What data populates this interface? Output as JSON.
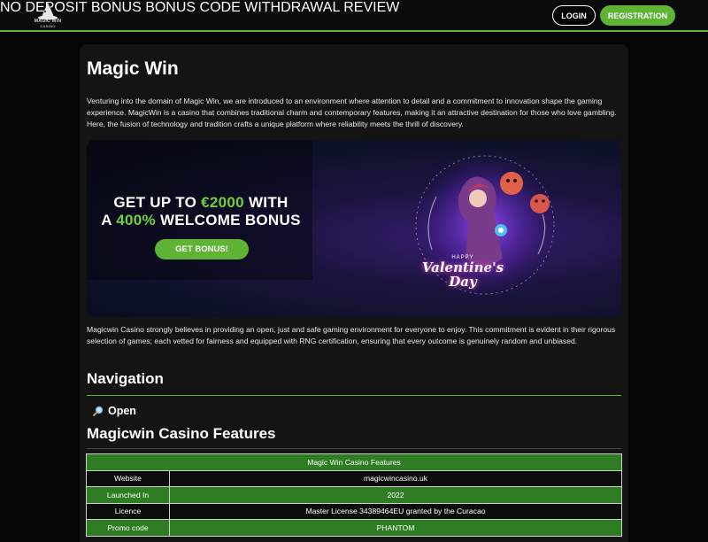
{
  "header": {
    "logo_text_line1": "MAGIC WIN",
    "logo_text_line2": "CASINO",
    "nav": [
      "NO DEPOSIT BONUS",
      "BONUS CODE",
      "WITHDRAWAL",
      "REVIEW"
    ],
    "login_label": "LOGIN",
    "register_label": "REGISTRATION"
  },
  "colors": {
    "accent": "#5fb335",
    "background": "#050505",
    "card": "#141414",
    "table_green": "#2e7d23"
  },
  "main": {
    "title": "Magic Win",
    "intro": "Venturing into the domain of Magic Win, we are introduced to an environment where attention to detail and a commitment to innovation shape the gaming experience. MagicWin is a casino that combines traditional charm and contemporary features, making it an attractive destination for those who love gambling. Here, the fusion of technology and tradition crafts a unique platform where reliability meets the thrill of discovery.",
    "banner": {
      "line1_pre": "GET UP TO ",
      "line1_amount": "€2000",
      "line1_post": " WITH",
      "line2_pre": "A ",
      "line2_percent": "400%",
      "line2_post": " WELCOME BONUS",
      "button": "GET BONUS!",
      "art_happy": "HAPPY",
      "art_title_1": "Valentine's",
      "art_title_2": "Day"
    },
    "paragraph2": "Magicwin Casino strongly believes in providing an open, just and safe gaming environment for everyone to enjoy. This commitment is evident in their rigorous selection of games; each vetted for fairness and equipped with RNG certification, ensuring that every outcome is genuinely random and unbiased.",
    "navigation_heading": "Navigation",
    "open_label": "Open",
    "features_heading": "Magicwin Casino Features",
    "table": {
      "caption": "Magic Win Casino Features",
      "rows": [
        {
          "label": "Website",
          "value": "magicwincasino.uk"
        },
        {
          "label": "Launched In",
          "value": "2022"
        },
        {
          "label": "Licence",
          "value": "Master License 34389464EU granted by the Curacao"
        },
        {
          "label": "Promo code",
          "value": "PHANTOM"
        }
      ]
    }
  }
}
